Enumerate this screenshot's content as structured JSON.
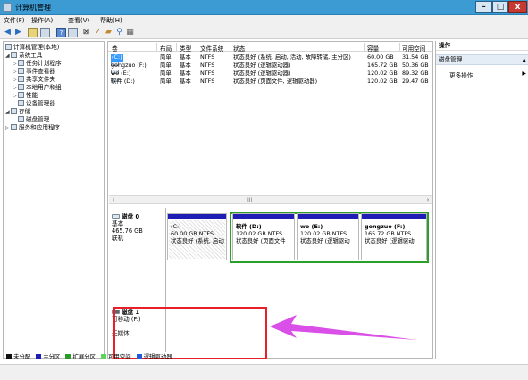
{
  "window": {
    "title": "计算机管理"
  },
  "menu": {
    "file": "文件(F)",
    "action": "操作(A)",
    "view": "查看(V)",
    "help": "帮助(H)"
  },
  "tree": {
    "root": "计算机管理(本地)",
    "system_tools": "系统工具",
    "task_scheduler": "任务计划程序",
    "event_viewer": "事件查看器",
    "shared_folders": "共享文件夹",
    "local_users": "本地用户和组",
    "performance": "性能",
    "device_manager": "设备管理器",
    "storage": "存储",
    "disk_management": "磁盘管理",
    "services": "服务和应用程序"
  },
  "volume_table": {
    "headers": [
      "卷",
      "布局",
      "类型",
      "文件系统",
      "状态",
      "容量",
      "可用空间"
    ],
    "rows": [
      [
        "(C:)",
        "简单",
        "基本",
        "NTFS",
        "状态良好 (系统, 启动, 活动, 故障转储, 主分区)",
        "60.00 GB",
        "31.54 GB"
      ],
      [
        "gongzuo (F:)",
        "简单",
        "基本",
        "NTFS",
        "状态良好 (逻辑驱动器)",
        "165.72 GB",
        "50.36 GB"
      ],
      [
        "wo (E:)",
        "简单",
        "基本",
        "NTFS",
        "状态良好 (逻辑驱动器)",
        "120.02 GB",
        "89.32 GB"
      ],
      [
        "软件 (D:)",
        "简单",
        "基本",
        "NTFS",
        "状态良好 (页面文件, 逻辑驱动器)",
        "120.02 GB",
        "29.47 GB"
      ]
    ]
  },
  "scroll_grip": "III",
  "disk0": {
    "name": "磁盘 0",
    "type": "基本",
    "size": "465.76 GB",
    "status": "联机",
    "partitions": [
      {
        "label": "(C:)",
        "size": "60.00 GB NTFS",
        "status": "状态良好 (系统, 启动"
      },
      {
        "label": "软件 (D:)",
        "size": "120.02 GB NTFS",
        "status": "状态良好 (页面文件"
      },
      {
        "label": "wo (E:)",
        "size": "120.02 GB NTFS",
        "status": "状态良好 (逻辑驱动"
      },
      {
        "label": "gongzuo (F:)",
        "size": "165.72 GB NTFS",
        "status": "状态良好 (逻辑驱动"
      }
    ]
  },
  "disk1": {
    "name": "磁盘 1",
    "type": "可移动 (F:)",
    "media": "无媒体"
  },
  "legend": [
    {
      "label": "未分配",
      "color": "#111111"
    },
    {
      "label": "主分区",
      "color": "#1e1eb4"
    },
    {
      "label": "扩展分区",
      "color": "#2a9a2a"
    },
    {
      "label": "可用空间",
      "color": "#5ad65a"
    },
    {
      "label": "逻辑驱动器",
      "color": "#1e5adc"
    }
  ],
  "actions": {
    "title": "操作",
    "section": "磁盘管理",
    "more": "更多操作"
  }
}
